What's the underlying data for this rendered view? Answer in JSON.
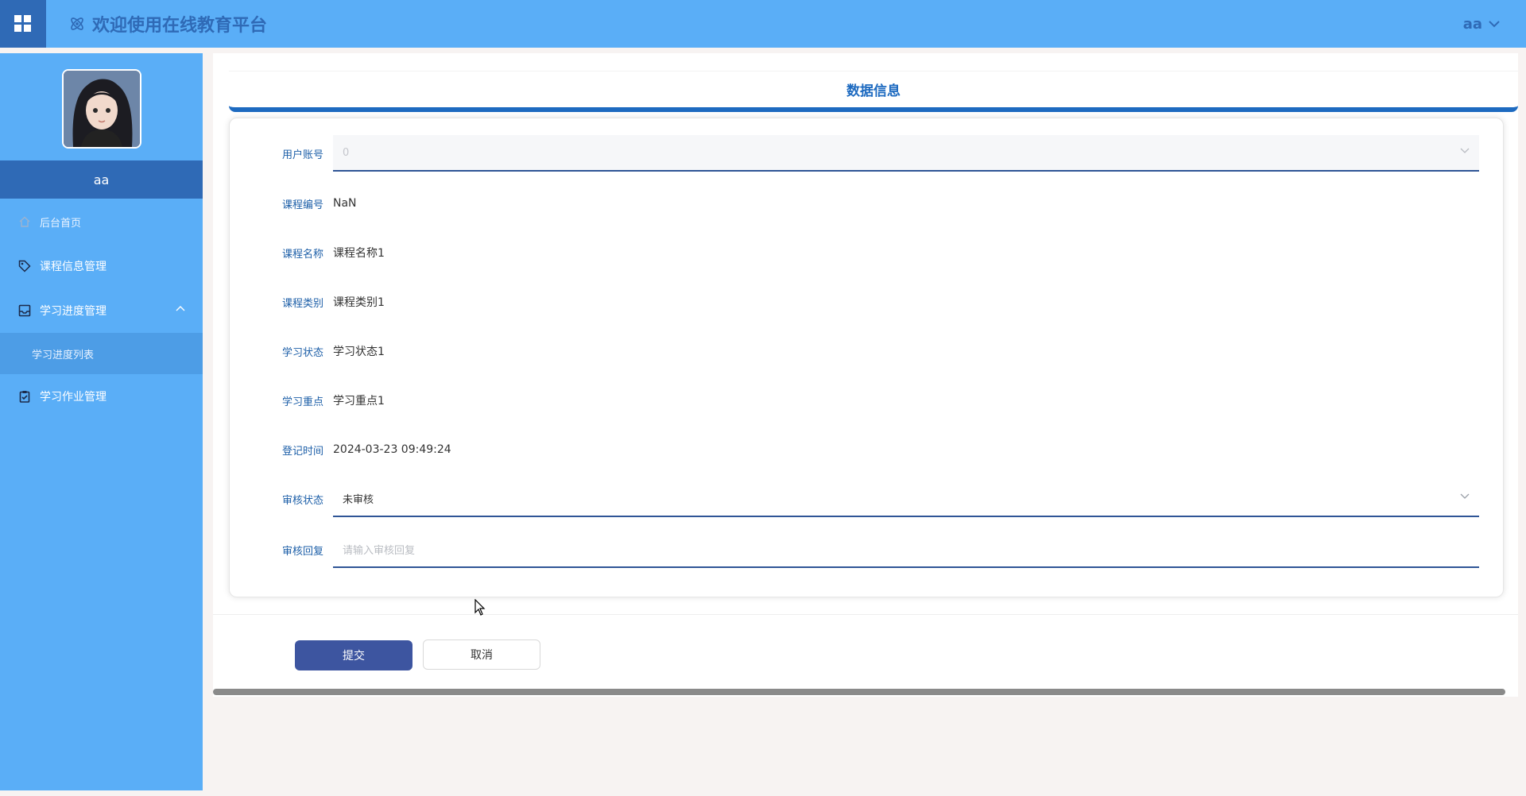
{
  "header": {
    "app_title": "欢迎使用在线教育平台",
    "user_name": "aa",
    "menu_icon": "grid-menu-icon",
    "logo_icon": "atom-logo-icon"
  },
  "sidebar": {
    "username": "aa",
    "items": [
      {
        "label": "后台首页",
        "icon": "home-icon"
      },
      {
        "label": "课程信息管理",
        "icon": "tag-icon"
      },
      {
        "label": "学习进度管理",
        "icon": "inbox-icon"
      },
      {
        "label": "学习作业管理",
        "icon": "clipboard-check-icon"
      }
    ],
    "sub_items": [
      {
        "label": "学习进度列表"
      }
    ]
  },
  "panel": {
    "title": "数据信息"
  },
  "form": {
    "user_account": {
      "label": "用户账号",
      "value": "0"
    },
    "course_no": {
      "label": "课程编号",
      "value": "NaN"
    },
    "course_name": {
      "label": "课程名称",
      "value": "课程名称1"
    },
    "course_type": {
      "label": "课程类别",
      "value": "课程类别1"
    },
    "study_status": {
      "label": "学习状态",
      "value": "学习状态1"
    },
    "study_focus": {
      "label": "学习重点",
      "value": "学习重点1"
    },
    "register_time": {
      "label": "登记时间",
      "value": "2024-03-23 09:49:24"
    },
    "review_status": {
      "label": "审核状态",
      "value": "未审核"
    },
    "review_reply": {
      "label": "审核回复",
      "placeholder": "请输入审核回复"
    }
  },
  "buttons": {
    "submit": "提交",
    "cancel": "取消"
  },
  "colors": {
    "topbar": "#5aaef7",
    "accent": "#2f6ab6",
    "title": "#1d6ac0",
    "submit": "#3d55a0"
  }
}
